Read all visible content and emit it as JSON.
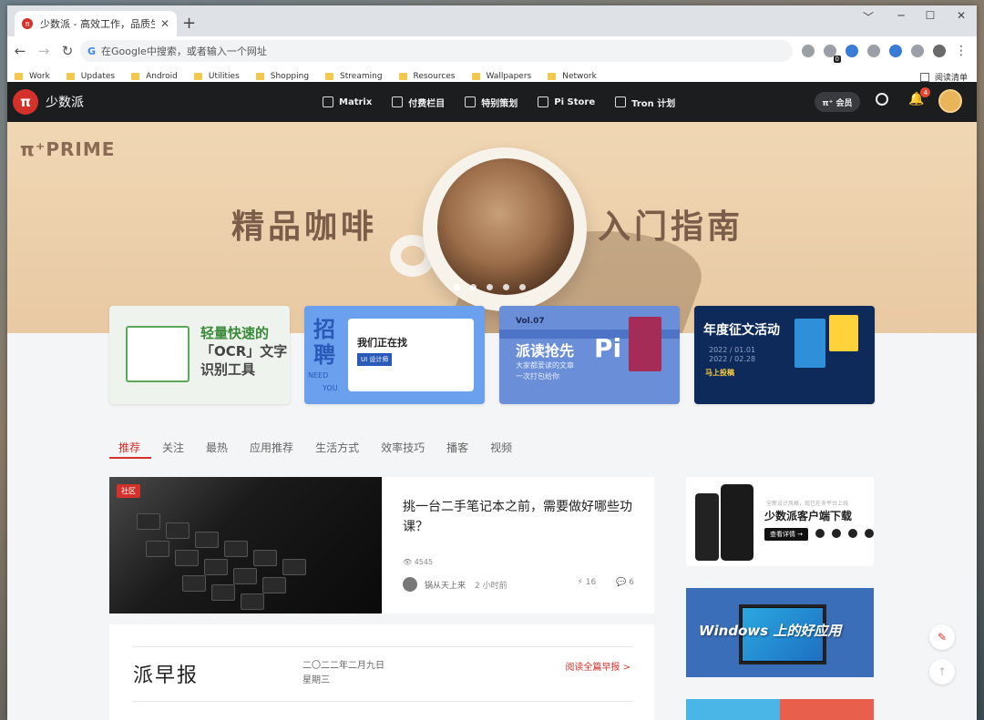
{
  "browser": {
    "tab_title": "少数派 - 高效工作，品质生活",
    "tab_close": "✕",
    "new_tab": "+",
    "window_controls": [
      "﹀",
      "─",
      "☐",
      "✕"
    ],
    "omnibox_placeholder": "在Google中搜索，或者输入一个网址",
    "omnibox_icon": "G",
    "extension_badge": "0",
    "kebab": "⋮",
    "bookmarks": [
      "Work",
      "Updates",
      "Android",
      "Utilities",
      "Shopping",
      "Streaming",
      "Resources",
      "Wallpapers",
      "Network"
    ],
    "reading_list": "阅读清单"
  },
  "site": {
    "logo_glyph": "π",
    "name": "少数派",
    "nav": [
      "Matrix",
      "付费栏目",
      "特别策划",
      "Pi Store",
      "Tron 计划"
    ],
    "member_label": "π⁺ 会员",
    "notification_count": "4"
  },
  "hero": {
    "brand": "π⁺PRIME",
    "left_text": "精品咖啡",
    "right_text": "入门指南"
  },
  "cards": {
    "c1": {
      "line1": "轻量快速的",
      "line2": "「OCR」文字",
      "line3": "识别工具"
    },
    "c2": {
      "big": "招聘",
      "heading": "我们正在找",
      "tag": "UI 设计师",
      "need": "NEED",
      "you": "YOU"
    },
    "c3": {
      "vol": "Vol.07",
      "title": "派读抢先",
      "sub1": "大家都爱读的文章",
      "sub2": "一次打包给你",
      "pi": "Pi"
    },
    "c4": {
      "title": "年度征文活动",
      "d1": "2022 / 01.01",
      "d2": "2022 / 02.28",
      "go": "马上投稿"
    }
  },
  "category_tabs": [
    "推荐",
    "关注",
    "最热",
    "应用推荐",
    "生活方式",
    "效率技巧",
    "播客",
    "视频"
  ],
  "article": {
    "badge": "社区",
    "title": "挑一台二手笔记本之前，需要做好哪些功课？",
    "views": "4545",
    "author": "锅从天上来",
    "time": "2 小时前",
    "likes": "16",
    "comments": "6"
  },
  "daily": {
    "name": "派早报",
    "date": "二〇二二年二月九日",
    "weekday": "星期三",
    "more": "阅读全篇早报 >"
  },
  "sidebar": {
    "download_sub": "全新设计风格，现已在多平台上线",
    "download_title": "少数派客户端下载",
    "download_btn": "查看详情 →",
    "windows_title": "Windows 上的好应用"
  },
  "colors": {
    "accent": "#d5312b",
    "header_bg": "#1c1d1f"
  }
}
